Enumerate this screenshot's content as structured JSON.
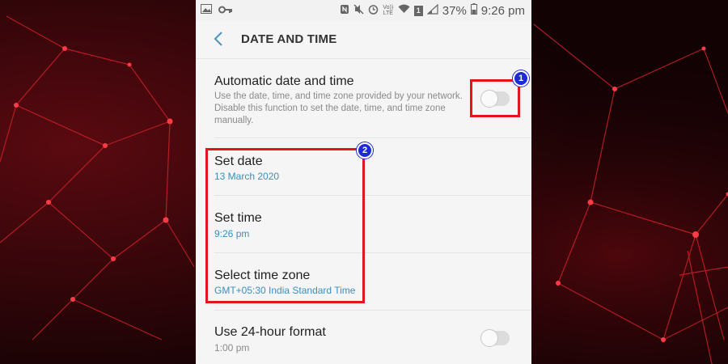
{
  "statusbar": {
    "battery_percent": "37%",
    "time": "9:26 pm",
    "volte_label": "Vo)) LTE",
    "sim_label": "1"
  },
  "header": {
    "title": "DATE AND TIME"
  },
  "settings": {
    "automatic": {
      "label": "Automatic date and time",
      "description": "Use the date, time, and time zone provided by your network. Disable this function to set the date, time, and time zone manually.",
      "enabled": false
    },
    "set_date": {
      "label": "Set date",
      "value": "13 March 2020"
    },
    "set_time": {
      "label": "Set time",
      "value": "9:26 pm"
    },
    "time_zone": {
      "label": "Select time zone",
      "value": "GMT+05:30 India Standard Time"
    },
    "hour24": {
      "label": "Use 24-hour format",
      "value": "1:00 pm",
      "enabled": false
    }
  },
  "annotations": {
    "badge1": "1",
    "badge2": "2"
  },
  "colors": {
    "accent_blue": "#3a8fc0",
    "highlight_red": "#e3141c",
    "badge_blue": "#1d2ad8"
  }
}
